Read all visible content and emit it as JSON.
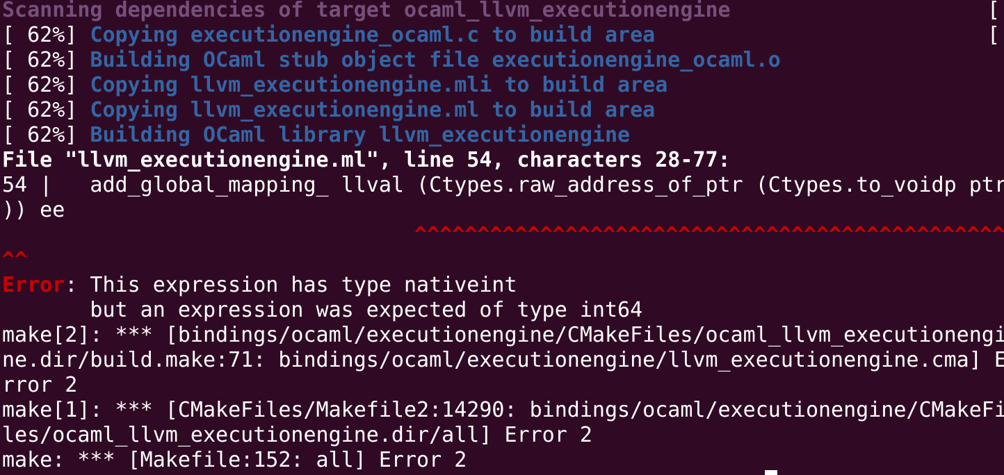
{
  "terminal": {
    "scanning": "Scanning dependencies of target ocaml_llvm_executionengine",
    "build_lines": [
      {
        "progress": "[ 62%] ",
        "text": "Copying executionengine_ocaml.c to build area"
      },
      {
        "progress": "[ 62%] ",
        "text": "Building OCaml stub object file executionengine_ocaml.o"
      },
      {
        "progress": "[ 62%] ",
        "text": "Copying llvm_executionengine.mli to build area"
      },
      {
        "progress": "[ 62%] ",
        "text": "Copying llvm_executionengine.ml to build area"
      },
      {
        "progress": "[ 62%] ",
        "text": "Building OCaml library llvm_executionengine"
      }
    ],
    "file_location": "File \"llvm_executionengine.ml\", line 54, characters 28-77:",
    "code_line": "54 |   add_global_mapping_ llval (Ctypes.raw_address_of_ptr (Ctypes.to_voidp ptr",
    "code_line_cont": ")) ee",
    "carets_1": "^^^^^^^^^^^^^^^^^^^^^^^^^^^^^^^^^^^^^^^^^^^^^^^^^^^",
    "carets_2": "^^",
    "error_label": "Error",
    "error_msg": ": This expression has type nativeint",
    "error_msg_2": "       but an expression was expected of type int64",
    "make_lines": [
      "make[2]: *** [bindings/ocaml/executionengine/CMakeFiles/ocaml_llvm_executionengi",
      "ne.dir/build.make:71: bindings/ocaml/executionengine/llvm_executionengine.cma] E",
      "rror 2",
      "make[1]: *** [CMakeFiles/Makefile2:14290: bindings/ocaml/executionengine/CMakeFi",
      "les/ocaml_llvm_executionengine.dir/all] Error 2",
      "make: *** [Makefile:152: all] Error 2"
    ],
    "right_edge": [
      "[",
      "["
    ]
  }
}
